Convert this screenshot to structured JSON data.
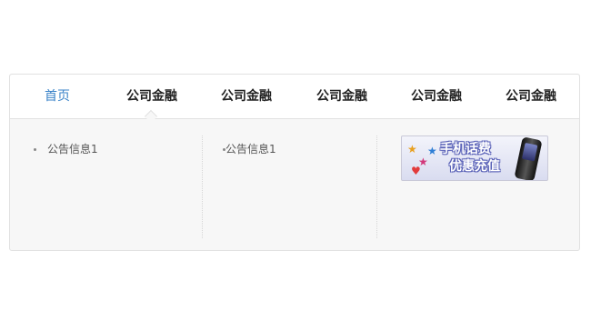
{
  "nav": {
    "items": [
      {
        "label": "首页",
        "active": true
      },
      {
        "label": "公司金融",
        "active": false
      },
      {
        "label": "公司金融",
        "active": false
      },
      {
        "label": "公司金融",
        "active": false
      },
      {
        "label": "公司金融",
        "active": false
      },
      {
        "label": "公司金融",
        "active": false
      }
    ]
  },
  "panel": {
    "columns": [
      {
        "items": [
          {
            "label": "公告信息1"
          }
        ]
      },
      {
        "items": [
          {
            "label": "公告信息1"
          }
        ]
      }
    ],
    "ad": {
      "line1": "手机话费",
      "line2": "优惠充值",
      "accent": "#5b63b8"
    }
  },
  "colors": {
    "active_nav": "#3a83c8",
    "nav_text": "#222222",
    "panel_bg": "#f7f7f7",
    "border": "#e1e1e1"
  }
}
